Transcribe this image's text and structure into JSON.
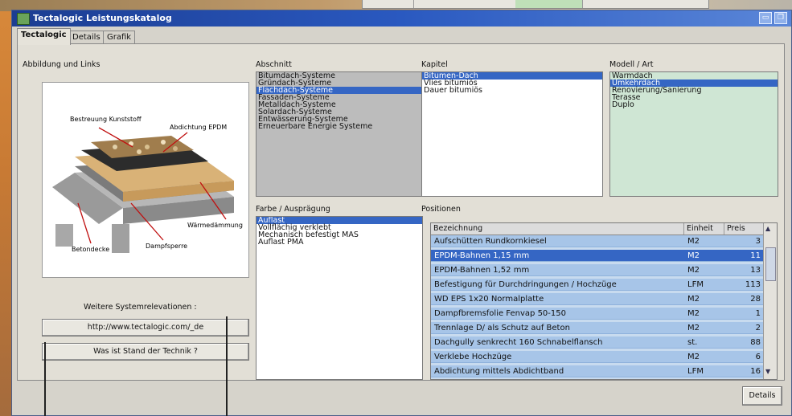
{
  "window": {
    "title": "Tectalogic Leistungskatalog"
  },
  "tabs": [
    {
      "label": "Tectalogic",
      "active": true
    },
    {
      "label": "Details",
      "active": false
    },
    {
      "label": "Grafik",
      "active": false
    }
  ],
  "left": {
    "image_label": "Abbildung und Links",
    "diagram_labels": {
      "a": "Bestreuung Kunststoff",
      "b": "Abdichtung EPDM",
      "c": "Wärmedämmung",
      "d": "Dampfsperre",
      "e": "Betondecke"
    },
    "more_label": "Weitere Systemrelevationen :",
    "link_button": "http://www.tectalogic.com/_de",
    "question_button": "Was ist Stand der Technik ?"
  },
  "abschnitt": {
    "label": "Abschnitt",
    "items": [
      "Bitumdach-Systeme",
      "Gründach-Systeme",
      "Flachdach-Systeme",
      "Fassaden-Systeme",
      "Metalldach-Systeme",
      "Solardach-Systeme",
      "Entwässerung-Systeme",
      "Erneuerbare Energie Systeme"
    ],
    "selected": 2
  },
  "kapitel": {
    "label": "Kapitel",
    "items": [
      "Bitumen-Dach",
      "Vlies bitumiös",
      "Dauer bitumiös"
    ],
    "selected": 0
  },
  "modell": {
    "label": "Modell / Art",
    "items": [
      "Warmdach",
      "Umkehrdach",
      "Renovierung/Sanierung",
      "Terasse",
      "Duplo"
    ],
    "selected": 1
  },
  "farbe": {
    "label": "Farbe / Ausprägung",
    "items": [
      "Auflast",
      "Vollflächig verklebt",
      "Mechanisch befestigt MAS",
      "Auflast PMA"
    ],
    "selected": 0
  },
  "positionen": {
    "label": "Positionen",
    "columns": [
      "Bezeichnung",
      "Einheit",
      "Preis"
    ],
    "rows": [
      {
        "desc": "Aufschütten Rundkornkiesel",
        "unit": "M2",
        "price": "3"
      },
      {
        "desc": "EPDM-Bahnen 1,15 mm",
        "unit": "M2",
        "price": "11"
      },
      {
        "desc": "EPDM-Bahnen 1,52 mm",
        "unit": "M2",
        "price": "13"
      },
      {
        "desc": "Befestigung für Durchdringungen / Hochzüge",
        "unit": "LFM",
        "price": "113"
      },
      {
        "desc": "WD EPS 1x20 Normalplatte",
        "unit": "M2",
        "price": "28"
      },
      {
        "desc": "Dampfbremsfolie Fenvap 50-150",
        "unit": "M2",
        "price": "1"
      },
      {
        "desc": "Trennlage D/ als Schutz auf Beton",
        "unit": "M2",
        "price": "2"
      },
      {
        "desc": "Dachgully senkrecht 160 Schnabelflansch",
        "unit": "st.",
        "price": "88"
      },
      {
        "desc": "Verklebe Hochzüge",
        "unit": "M2",
        "price": "6"
      },
      {
        "desc": "Abdichtung mittels Abdichtband",
        "unit": "LFM",
        "price": "16"
      }
    ],
    "selected": 1
  },
  "details_button": "Details"
}
